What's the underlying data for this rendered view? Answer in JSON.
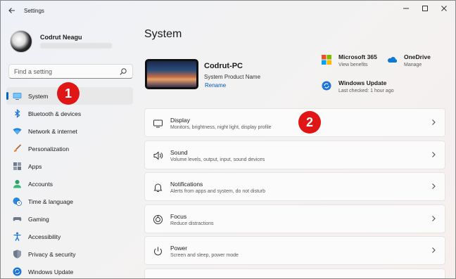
{
  "window": {
    "title": "Settings",
    "back_icon": "arrow-left-icon",
    "controls": [
      "minimize-icon",
      "maximize-icon",
      "close-icon"
    ]
  },
  "user": {
    "name": "Codrut Neagu"
  },
  "search": {
    "placeholder": "Find a setting",
    "icon": "search-icon"
  },
  "sidebar": {
    "items": [
      {
        "label": "System",
        "icon": "monitor-icon",
        "active": true
      },
      {
        "label": "Bluetooth & devices",
        "icon": "bluetooth-icon"
      },
      {
        "label": "Network & internet",
        "icon": "wifi-icon"
      },
      {
        "label": "Personalization",
        "icon": "brush-icon"
      },
      {
        "label": "Apps",
        "icon": "apps-icon"
      },
      {
        "label": "Accounts",
        "icon": "person-icon"
      },
      {
        "label": "Time & language",
        "icon": "globe-clock-icon"
      },
      {
        "label": "Gaming",
        "icon": "gamepad-icon"
      },
      {
        "label": "Accessibility",
        "icon": "accessibility-icon"
      },
      {
        "label": "Privacy & security",
        "icon": "shield-icon"
      },
      {
        "label": "Windows Update",
        "icon": "refresh-icon"
      }
    ]
  },
  "main": {
    "title": "System",
    "device": {
      "name": "Codrut-PC",
      "model": "System Product Name",
      "rename": "Rename"
    },
    "quick": {
      "m365": {
        "title": "Microsoft 365",
        "sub": "View benefits"
      },
      "onedrive": {
        "title": "OneDrive",
        "sub": "Manage"
      },
      "update": {
        "title": "Windows Update",
        "sub": "Last checked: 1 hour ago"
      }
    },
    "cards": [
      {
        "title": "Display",
        "sub": "Monitors, brightness, night light, display profile",
        "icon": "display-icon"
      },
      {
        "title": "Sound",
        "sub": "Volume levels, output, input, sound devices",
        "icon": "speaker-icon"
      },
      {
        "title": "Notifications",
        "sub": "Alerts from apps and system, do not disturb",
        "icon": "bell-icon"
      },
      {
        "title": "Focus",
        "sub": "Reduce distractions",
        "icon": "focus-icon"
      },
      {
        "title": "Power",
        "sub": "Screen and sleep, power mode",
        "icon": "power-icon"
      }
    ]
  },
  "annotations": {
    "badge1": "1",
    "badge2": "2"
  },
  "colors": {
    "accent": "#0067c0",
    "badge": "#e01515"
  }
}
